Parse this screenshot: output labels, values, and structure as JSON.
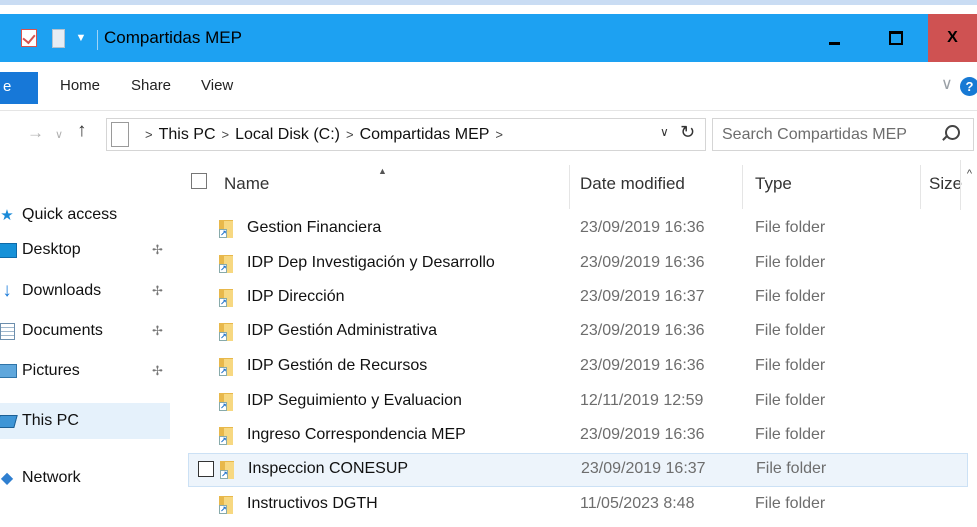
{
  "window": {
    "title": "Compartidas MEP",
    "controls": {
      "minimize": "",
      "maximize": "",
      "close": "X"
    }
  },
  "ribbon": {
    "file_tab": "e",
    "tabs": [
      "Home",
      "Share",
      "View"
    ],
    "collapse_glyph": "∨",
    "help_glyph": "?"
  },
  "address": {
    "crumbs": [
      "This PC",
      "Local Disk (C:)",
      "Compartidas MEP"
    ],
    "search_placeholder": "Search Compartidas MEP"
  },
  "nav_pane": {
    "items": [
      {
        "label": "Quick access",
        "icon": "star-icon",
        "pinned": false
      },
      {
        "label": "Desktop",
        "icon": "desktop-icon",
        "pinned": true
      },
      {
        "label": "Downloads",
        "icon": "download-icon",
        "pinned": true
      },
      {
        "label": "Documents",
        "icon": "documents-icon",
        "pinned": true
      },
      {
        "label": "Pictures",
        "icon": "pictures-icon",
        "pinned": true
      },
      {
        "label": "This PC",
        "icon": "this-pc-icon",
        "pinned": false,
        "selected": true
      },
      {
        "label": "Network",
        "icon": "network-icon",
        "pinned": false
      }
    ]
  },
  "file_list": {
    "columns": [
      "Name",
      "Date modified",
      "Type",
      "Size"
    ],
    "rows": [
      {
        "name": "Gestion Financiera",
        "date": "23/09/2019 16:36",
        "type": "File folder"
      },
      {
        "name": "IDP Dep Investigación y Desarrollo",
        "date": "23/09/2019 16:36",
        "type": "File folder"
      },
      {
        "name": "IDP Dirección",
        "date": "23/09/2019 16:37",
        "type": "File folder"
      },
      {
        "name": "IDP Gestión Administrativa",
        "date": "23/09/2019 16:36",
        "type": "File folder"
      },
      {
        "name": "IDP Gestión de Recursos",
        "date": "23/09/2019 16:36",
        "type": "File folder"
      },
      {
        "name": "IDP Seguimiento y Evaluacion",
        "date": "12/11/2019 12:59",
        "type": "File folder"
      },
      {
        "name": "Ingreso Correspondencia MEP",
        "date": "23/09/2019 16:36",
        "type": "File folder"
      },
      {
        "name": "Inspeccion CONESUP",
        "date": "23/09/2019 16:37",
        "type": "File folder",
        "hover": true
      },
      {
        "name": "Instructivos DGTH",
        "date": "11/05/2023 8:48",
        "type": "File folder"
      }
    ]
  }
}
